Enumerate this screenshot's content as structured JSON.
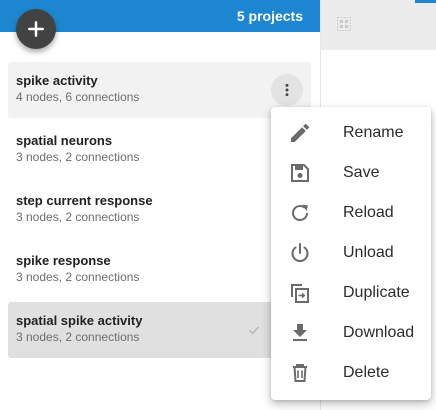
{
  "header": {
    "project_count": "5 projects"
  },
  "fab": {
    "icon": "plus-icon"
  },
  "projects": [
    {
      "name": "spike activity",
      "meta": "4 nodes, 6 connections",
      "state": "hover"
    },
    {
      "name": "spatial neurons",
      "meta": "3 nodes, 2 connections",
      "state": "normal"
    },
    {
      "name": "step current response",
      "meta": "3 nodes, 2 connections",
      "state": "normal"
    },
    {
      "name": "spike response",
      "meta": "3 nodes, 2 connections",
      "state": "normal"
    },
    {
      "name": "spatial spike activity",
      "meta": "3 nodes, 2 connections",
      "state": "selected"
    }
  ],
  "menu": {
    "items": [
      {
        "label": "Rename",
        "icon": "pencil-icon"
      },
      {
        "label": "Save",
        "icon": "save-icon"
      },
      {
        "label": "Reload",
        "icon": "reload-icon"
      },
      {
        "label": "Unload",
        "icon": "power-icon"
      },
      {
        "label": "Duplicate",
        "icon": "duplicate-icon"
      },
      {
        "label": "Download",
        "icon": "download-icon"
      },
      {
        "label": "Delete",
        "icon": "trash-icon"
      }
    ]
  },
  "colors": {
    "accent": "#1c87d0",
    "fab": "#424242",
    "hover_row": "#f2f2f2",
    "selected_row": "#e0e0e0"
  }
}
